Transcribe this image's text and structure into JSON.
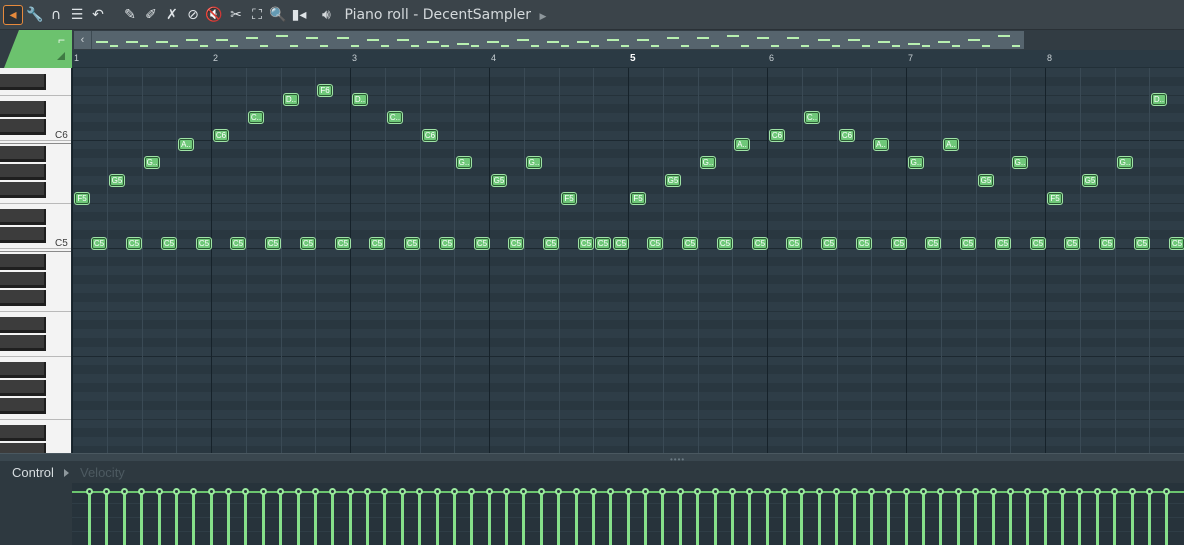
{
  "window": {
    "title": "Piano roll - DecentSampler"
  },
  "toolbar": {
    "tools": [
      {
        "name": "menu-arrow-icon",
        "glyph": "◂",
        "active": true
      },
      {
        "name": "wrench-icon",
        "glyph": "🔧"
      },
      {
        "name": "magnet-icon",
        "glyph": "∩"
      },
      {
        "name": "list-icon",
        "glyph": "☰"
      },
      {
        "name": "undo-icon",
        "glyph": "↶"
      },
      {
        "name": "pencil-icon",
        "glyph": "✎"
      },
      {
        "name": "paint-brush-icon",
        "glyph": "✐"
      },
      {
        "name": "delete-icon",
        "glyph": "✗"
      },
      {
        "name": "mute-icon",
        "glyph": "⊘"
      },
      {
        "name": "speaker-mute-icon",
        "glyph": "🔇"
      },
      {
        "name": "slice-icon",
        "glyph": "✂"
      },
      {
        "name": "select-icon",
        "glyph": "⛶"
      },
      {
        "name": "zoom-icon",
        "glyph": "🔍"
      },
      {
        "name": "playback-icon",
        "glyph": "▮◂"
      }
    ]
  },
  "ruler": {
    "bars": [
      "1",
      "2",
      "3",
      "4",
      "5",
      "6",
      "7",
      "8"
    ]
  },
  "keys": {
    "labels": [
      "C6",
      "C5"
    ]
  },
  "notes": [
    {
      "label": "F5",
      "pitch": "F5",
      "beat": 0
    },
    {
      "label": "G5",
      "pitch": "G5",
      "beat": 1
    },
    {
      "label": "G..",
      "pitch": "A5",
      "beat": 2
    },
    {
      "label": "A..",
      "pitch": "B5",
      "beat": 3
    },
    {
      "label": "C6",
      "pitch": "C6",
      "beat": 4
    },
    {
      "label": "C..",
      "pitch": "D6",
      "beat": 5
    },
    {
      "label": "D..",
      "pitch": "E6",
      "beat": 6
    },
    {
      "label": "F6",
      "pitch": "F6",
      "beat": 7
    },
    {
      "label": "D..",
      "pitch": "E6",
      "beat": 8
    },
    {
      "label": "C..",
      "pitch": "D6",
      "beat": 9
    },
    {
      "label": "C6",
      "pitch": "C6",
      "beat": 10
    },
    {
      "label": "G..",
      "pitch": "A5",
      "beat": 11
    },
    {
      "label": "G5",
      "pitch": "G5",
      "beat": 12
    },
    {
      "label": "G..",
      "pitch": "A5",
      "beat": 13
    },
    {
      "label": "F5",
      "pitch": "F5",
      "beat": 14
    },
    {
      "label": "F5",
      "pitch": "F5",
      "beat": 16
    },
    {
      "label": "G5",
      "pitch": "G5",
      "beat": 17
    },
    {
      "label": "G..",
      "pitch": "A5",
      "beat": 18
    },
    {
      "label": "A..",
      "pitch": "B5",
      "beat": 19
    },
    {
      "label": "C6",
      "pitch": "C6",
      "beat": 20
    },
    {
      "label": "C..",
      "pitch": "D6",
      "beat": 21
    },
    {
      "label": "C6",
      "pitch": "C6",
      "beat": 22
    },
    {
      "label": "A..",
      "pitch": "B5",
      "beat": 23
    },
    {
      "label": "G..",
      "pitch": "A5",
      "beat": 24
    },
    {
      "label": "A..",
      "pitch": "B5",
      "beat": 25
    },
    {
      "label": "G5",
      "pitch": "G5",
      "beat": 26
    },
    {
      "label": "G..",
      "pitch": "A5",
      "beat": 27
    },
    {
      "label": "F5",
      "pitch": "F5",
      "beat": 28
    },
    {
      "label": "G5",
      "pitch": "G5",
      "beat": 29
    },
    {
      "label": "G..",
      "pitch": "A5",
      "beat": 30
    },
    {
      "label": "D..",
      "pitch": "E6",
      "beat": 31
    }
  ],
  "bass_notes": {
    "label": "C5",
    "pitch": "C5",
    "beats": [
      0.5,
      1.5,
      2.5,
      3.5,
      4.5,
      5.5,
      6.5,
      7.5,
      8.5,
      9.5,
      10.5,
      11.5,
      12.5,
      13.5,
      14.5,
      15.0,
      15.5,
      16.5,
      17.5,
      18.5,
      19.5,
      20.5,
      21.5,
      22.5,
      23.5,
      24.5,
      25.5,
      26.5,
      27.5,
      28.5,
      29.5,
      30.5,
      31.5
    ]
  },
  "overview": {
    "pitch_levels": [
      2,
      2,
      2,
      3,
      3,
      4,
      5,
      4,
      4,
      3,
      3,
      2,
      1,
      2,
      3,
      2,
      2,
      3,
      3,
      4,
      4,
      5,
      4,
      4,
      3,
      3,
      2,
      1,
      2,
      3,
      5
    ]
  },
  "control": {
    "label": "Control",
    "parameter": "Velocity",
    "velocity_count": 64,
    "velocity_level": 0.8
  },
  "colors": {
    "note_fill": "#6fc879",
    "velocity": "#86e08a",
    "accent": "#e78a3c"
  }
}
